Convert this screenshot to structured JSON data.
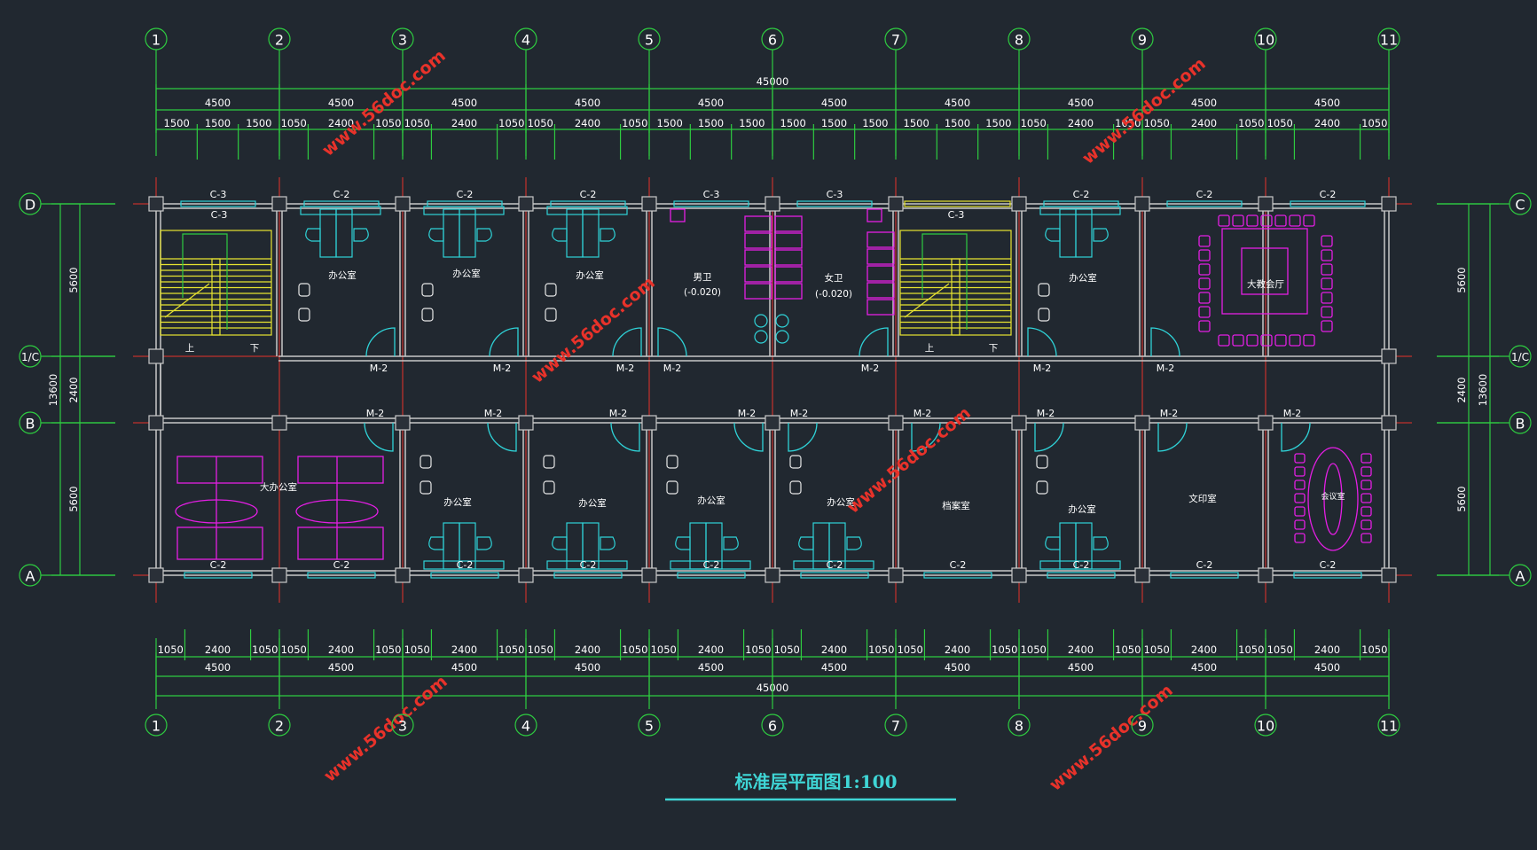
{
  "axes_columns": [
    "1",
    "2",
    "3",
    "4",
    "5",
    "6",
    "7",
    "8",
    "9",
    "10",
    "11"
  ],
  "axes_rows": [
    {
      "name": "D",
      "side": "left"
    },
    {
      "name": "C",
      "side": "right"
    },
    {
      "name": "1/C",
      "side": "both"
    },
    {
      "name": "B",
      "side": "both"
    },
    {
      "name": "A",
      "side": "both"
    }
  ],
  "dims": {
    "overall": "45000",
    "bay": "4500",
    "top_sub": [
      "1500",
      "1500",
      "1500",
      "1050",
      "2400",
      "1050",
      "1050",
      "2400",
      "1050",
      "1050",
      "2400",
      "1050",
      "1500",
      "1500",
      "1500",
      "1500",
      "1500",
      "1500",
      "1500",
      "1500",
      "1500",
      "1050",
      "2400",
      "1050",
      "1050",
      "2400",
      "1050",
      "1050",
      "2400",
      "1050"
    ],
    "bottom_sub": [
      "1050",
      "2400",
      "1050",
      "1050",
      "2400",
      "1050",
      "1050",
      "2400",
      "1050",
      "1050",
      "2400",
      "1050",
      "1050",
      "2400",
      "1050",
      "1050",
      "2400",
      "1050",
      "1050",
      "2400",
      "1050",
      "1050",
      "2400",
      "1050",
      "1050",
      "2400",
      "1050",
      "1050",
      "2400",
      "1050"
    ],
    "left_vertical": [
      "5600",
      "2400",
      "5600"
    ],
    "left_total": "13600",
    "right_vertical": [
      "5600",
      "2400",
      "5600"
    ],
    "right_total": "13600"
  },
  "rooms_top": [
    {
      "name": "办公室"
    },
    {
      "name": "办公室"
    },
    {
      "name": "办公室"
    },
    {
      "name": "男卫",
      "elev": "(-0.020)"
    },
    {
      "name": "女卫",
      "elev": "(-0.020)"
    },
    {
      "name": "办公室"
    },
    {
      "name": "大教会厅"
    }
  ],
  "rooms_bottom": [
    {
      "name": "大办公室"
    },
    {
      "name": "办公室"
    },
    {
      "name": "办公室"
    },
    {
      "name": "办公室"
    },
    {
      "name": "办公室"
    },
    {
      "name": "档案室"
    },
    {
      "name": "办公室"
    },
    {
      "name": "文印室"
    },
    {
      "name": "会议室"
    }
  ],
  "stairs": {
    "up": "上",
    "down": "下"
  },
  "windows_top": [
    "C-3",
    "C-2",
    "C-2",
    "C-2",
    "C-3",
    "C-3",
    "C-2",
    "C-2",
    "C-2"
  ],
  "windows_stair": [
    "C-3",
    "C-3"
  ],
  "windows_bottom": [
    "C-2",
    "C-2",
    "C-2",
    "C-2",
    "C-2",
    "C-2",
    "C-2",
    "C-2",
    "C-2",
    "C-2"
  ],
  "doors_top": [
    "M-2",
    "M-2",
    "M-2",
    "M-2",
    "M-2",
    "M-2",
    "M-2"
  ],
  "doors_bottom": [
    "M-2",
    "M-2",
    "M-2",
    "M-2",
    "M-2",
    "M-2",
    "M-2",
    "M-2",
    "M-2"
  ],
  "title": "标准层平面图1:100",
  "watermark": "www.56doc.com",
  "colors": {
    "background": "#212830",
    "axis": "#2ecc40",
    "wall": "#c8c8c8",
    "cyan": "#2fd3d8",
    "magenta": "#e41ee4",
    "yellow": "#e8e430",
    "red": "#e8322a",
    "title": "#3fd6d6"
  }
}
